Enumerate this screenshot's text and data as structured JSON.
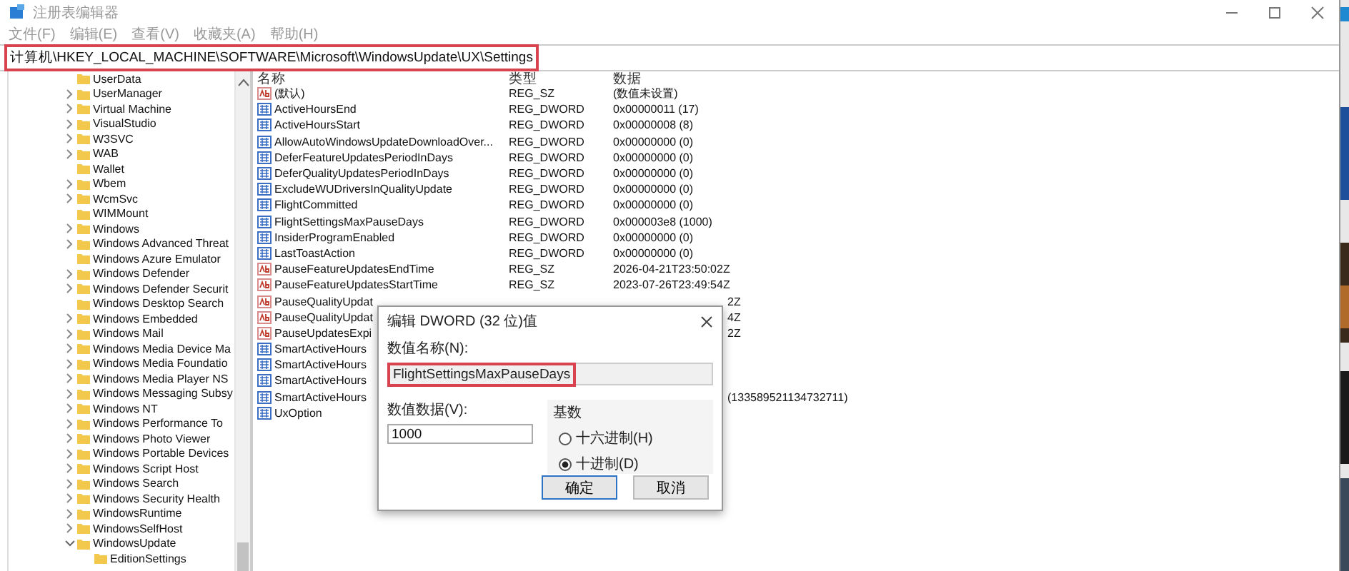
{
  "window": {
    "title": "注册表编辑器"
  },
  "menu": [
    "文件(F)",
    "编辑(E)",
    "查看(V)",
    "收藏夹(A)",
    "帮助(H)"
  ],
  "address": {
    "path": "计算机\\HKEY_LOCAL_MACHINE\\SOFTWARE\\Microsoft\\WindowsUpdate\\UX\\Settings",
    "highlighted": true
  },
  "tree": {
    "items": [
      {
        "label": "UserData",
        "expandable": false
      },
      {
        "label": "UserManager",
        "expandable": true,
        "expanded": false
      },
      {
        "label": "Virtual Machine",
        "expandable": true,
        "expanded": false
      },
      {
        "label": "VisualStudio",
        "expandable": true,
        "expanded": false
      },
      {
        "label": "W3SVC",
        "expandable": true,
        "expanded": false
      },
      {
        "label": "WAB",
        "expandable": true,
        "expanded": false
      },
      {
        "label": "Wallet",
        "expandable": false
      },
      {
        "label": "Wbem",
        "expandable": true,
        "expanded": false
      },
      {
        "label": "WcmSvc",
        "expandable": true,
        "expanded": false
      },
      {
        "label": "WIMMount",
        "expandable": false
      },
      {
        "label": "Windows",
        "expandable": true,
        "expanded": false
      },
      {
        "label": "Windows Advanced Threat",
        "expandable": true,
        "expanded": false
      },
      {
        "label": "Windows Azure Emulator",
        "expandable": false
      },
      {
        "label": "Windows Defender",
        "expandable": true,
        "expanded": false
      },
      {
        "label": "Windows Defender Securit",
        "expandable": true,
        "expanded": false
      },
      {
        "label": "Windows Desktop Search",
        "expandable": false
      },
      {
        "label": "Windows Embedded",
        "expandable": true,
        "expanded": false
      },
      {
        "label": "Windows Mail",
        "expandable": true,
        "expanded": false
      },
      {
        "label": "Windows Media Device Ma",
        "expandable": true,
        "expanded": false
      },
      {
        "label": "Windows Media Foundatio",
        "expandable": true,
        "expanded": false
      },
      {
        "label": "Windows Media Player NS",
        "expandable": true,
        "expanded": false
      },
      {
        "label": "Windows Messaging Subsy",
        "expandable": true,
        "expanded": false
      },
      {
        "label": "Windows NT",
        "expandable": true,
        "expanded": false
      },
      {
        "label": "Windows Performance To",
        "expandable": true,
        "expanded": false
      },
      {
        "label": "Windows Photo Viewer",
        "expandable": true,
        "expanded": false
      },
      {
        "label": "Windows Portable Devices",
        "expandable": true,
        "expanded": false
      },
      {
        "label": "Windows Script Host",
        "expandable": true,
        "expanded": false
      },
      {
        "label": "Windows Search",
        "expandable": true,
        "expanded": false
      },
      {
        "label": "Windows Security Health",
        "expandable": true,
        "expanded": false
      },
      {
        "label": "WindowsRuntime",
        "expandable": true,
        "expanded": false
      },
      {
        "label": "WindowsSelfHost",
        "expandable": true,
        "expanded": false
      },
      {
        "label": "WindowsUpdate",
        "expandable": true,
        "expanded": true,
        "children": [
          {
            "label": "EditionSettings",
            "expandable": false
          }
        ]
      }
    ]
  },
  "list": {
    "columns": [
      "名称",
      "类型",
      "数据"
    ],
    "rows": [
      {
        "kind": "sz",
        "name": "(默认)",
        "type": "REG_SZ",
        "data": "(数值未设置)"
      },
      {
        "kind": "dword",
        "name": "ActiveHoursEnd",
        "type": "REG_DWORD",
        "data": "0x00000011 (17)"
      },
      {
        "kind": "dword",
        "name": "ActiveHoursStart",
        "type": "REG_DWORD",
        "data": "0x00000008 (8)"
      },
      {
        "kind": "dword",
        "name": "AllowAutoWindowsUpdateDownloadOver...",
        "type": "REG_DWORD",
        "data": "0x00000000 (0)"
      },
      {
        "kind": "dword",
        "name": "DeferFeatureUpdatesPeriodInDays",
        "type": "REG_DWORD",
        "data": "0x00000000 (0)"
      },
      {
        "kind": "dword",
        "name": "DeferQualityUpdatesPeriodInDays",
        "type": "REG_DWORD",
        "data": "0x00000000 (0)"
      },
      {
        "kind": "dword",
        "name": "ExcludeWUDriversInQualityUpdate",
        "type": "REG_DWORD",
        "data": "0x00000000 (0)"
      },
      {
        "kind": "dword",
        "name": "FlightCommitted",
        "type": "REG_DWORD",
        "data": "0x00000000 (0)"
      },
      {
        "kind": "dword",
        "name": "FlightSettingsMaxPauseDays",
        "type": "REG_DWORD",
        "data": "0x000003e8 (1000)"
      },
      {
        "kind": "dword",
        "name": "InsiderProgramEnabled",
        "type": "REG_DWORD",
        "data": "0x00000000 (0)"
      },
      {
        "kind": "dword",
        "name": "LastToastAction",
        "type": "REG_DWORD",
        "data": "0x00000000 (0)"
      },
      {
        "kind": "sz",
        "name": "PauseFeatureUpdatesEndTime",
        "type": "REG_SZ",
        "data": "2026-04-21T23:50:02Z"
      },
      {
        "kind": "sz",
        "name": "PauseFeatureUpdatesStartTime",
        "type": "REG_SZ",
        "data": "2023-07-26T23:49:54Z"
      },
      {
        "kind": "sz",
        "name": "PauseQualityUpdat",
        "data_tail": "2Z"
      },
      {
        "kind": "sz",
        "name": "PauseQualityUpdat",
        "data_tail": "4Z"
      },
      {
        "kind": "sz",
        "name": "PauseUpdatesExpi",
        "data_tail": "2Z"
      },
      {
        "kind": "dword",
        "name": "SmartActiveHours"
      },
      {
        "kind": "dword",
        "name": "SmartActiveHours"
      },
      {
        "kind": "dword",
        "name": "SmartActiveHours"
      },
      {
        "kind": "dword",
        "name": "SmartActiveHours",
        "data_tail": "(133589521134732711)"
      },
      {
        "kind": "dword",
        "name": "UxOption"
      }
    ]
  },
  "dialog": {
    "title": "编辑 DWORD (32 位)值",
    "name_label": "数值名称(N):",
    "name_value": "FlightSettingsMaxPauseDays",
    "name_highlighted": true,
    "data_label": "数值数据(V):",
    "data_value": "1000",
    "base_label": "基数",
    "bases": [
      {
        "label": "十六进制(H)",
        "selected": false
      },
      {
        "label": "十进制(D)",
        "selected": true
      }
    ],
    "buttons": [
      {
        "label": "确定",
        "default": true
      },
      {
        "label": "取消",
        "default": false
      }
    ]
  }
}
